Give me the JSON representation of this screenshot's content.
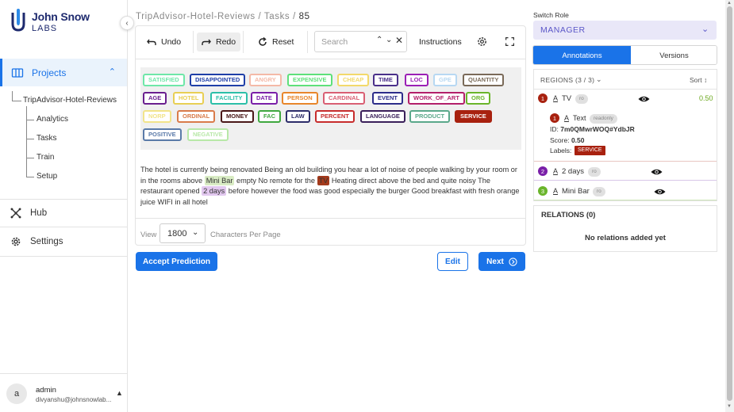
{
  "brand": {
    "name": "John Snow",
    "sub": "LABS",
    "color": "#1e2a6e"
  },
  "sidebar": {
    "projects_label": "Projects",
    "project_name": "TripAdvisor-Hotel-Reviews",
    "sub_items": [
      "Analytics",
      "Tasks",
      "Train",
      "Setup"
    ],
    "hub_label": "Hub",
    "settings_label": "Settings",
    "user": {
      "avatar_letter": "a",
      "name": "admin",
      "email": "divyanshu@johnsnowlab..."
    }
  },
  "breadcrumb": {
    "project": "TripAdvisor-Hotel-Reviews",
    "sep": "/",
    "section": "Tasks",
    "current": "85"
  },
  "toolbar": {
    "undo": "Undo",
    "redo": "Redo",
    "reset": "Reset",
    "search_placeholder": "Search",
    "instructions": "Instructions"
  },
  "labels": [
    {
      "text": "SATISFIED",
      "color": "#6ee7a8"
    },
    {
      "text": "DISAPPOINTED",
      "color": "#1f3fa8"
    },
    {
      "text": "ANGRY",
      "color": "#f4b9a7"
    },
    {
      "text": "EXPENSIVE",
      "color": "#5ee07a"
    },
    {
      "text": "CHEAP",
      "color": "#f2d96b"
    },
    {
      "text": "TIME",
      "color": "#4a2f8a"
    },
    {
      "text": "LOC",
      "color": "#9b1fb5"
    },
    {
      "text": "GPE",
      "color": "#b7d8f2"
    },
    {
      "text": "QUANTITY",
      "color": "#7a6a58"
    },
    {
      "text": "AGE",
      "color": "#6a1f8f"
    },
    {
      "text": "HOTEL",
      "color": "#e8cf54"
    },
    {
      "text": "FACILITY",
      "color": "#2cbfa8"
    },
    {
      "text": "DATE",
      "color": "#7a1fa8"
    },
    {
      "text": "PERSON",
      "color": "#e8862b"
    },
    {
      "text": "CARDINAL",
      "color": "#d95f73"
    },
    {
      "text": "EVENT",
      "color": "#2d2d8a"
    },
    {
      "text": "WORK_OF_ART",
      "color": "#b31f6a"
    },
    {
      "text": "ORG",
      "color": "#6ab52b"
    },
    {
      "text": "NORP",
      "color": "#f2e48a"
    },
    {
      "text": "ORDINAL",
      "color": "#d97b4a"
    },
    {
      "text": "MONEY",
      "color": "#4a1818"
    },
    {
      "text": "FAC",
      "color": "#3fa83f"
    },
    {
      "text": "LAW",
      "color": "#2d2d6a"
    },
    {
      "text": "PERCENT",
      "color": "#c72d2d"
    },
    {
      "text": "LANGUAGE",
      "color": "#3a1f5a"
    },
    {
      "text": "PRODUCT",
      "color": "#5aa88a"
    },
    {
      "text": "SERVICE",
      "color": "#a8210f"
    },
    {
      "text": "POSITIVE",
      "color": "#5a7aa8"
    },
    {
      "text": "NEGATIVE",
      "color": "#b8e8a8"
    }
  ],
  "text": {
    "s1": "The hotel is currently being renovated Being an old building you hear a lot of noise of people walking by your room or in the rooms above ",
    "h1": "Mini Bar",
    "s2": " empty No remote for the ",
    "h2": "TV",
    "s3": " Heating direct above the bed and quite noisy The restaurant opened ",
    "h3": "2 days",
    "s4": " before however the food was good especially the burger Good breakfast with fresh orange juice WIFI in all hotel"
  },
  "view": {
    "label": "View",
    "value": "1800",
    "suffix": "Characters Per Page"
  },
  "actions": {
    "accept": "Accept Prediction",
    "edit": "Edit",
    "next": "Next"
  },
  "right": {
    "switch_role_label": "Switch Role",
    "role": "MANAGER",
    "tabs": [
      "Annotations",
      "Versions"
    ],
    "regions_title": "REGIONS (3 / 3)",
    "sort_label": "Sort",
    "regions": [
      {
        "num": "1",
        "label": "TV",
        "ro": "ro",
        "score": "0.50",
        "color": "#a8210f"
      },
      {
        "num": "2",
        "label": "2 days",
        "ro": "ro",
        "color": "#7a1fa8"
      },
      {
        "num": "3",
        "label": "Mini Bar",
        "ro": "ro",
        "color": "#6ab52b"
      }
    ],
    "detail": {
      "num": "1",
      "label": "Text",
      "badge": "readonly",
      "id_label": "ID:",
      "id_value": "7m0QMwrWOQ#YdbJR",
      "score_label": "Score:",
      "score_value": "0.50",
      "labels_label": "Labels:",
      "labels_value": "SERVICE"
    },
    "relations_title": "RELATIONS (0)",
    "relations_empty": "No relations added yet"
  },
  "colors": {
    "accent": "#1a73e8",
    "role_bg": "#e9e7f8",
    "role_text": "#5b57c8"
  }
}
